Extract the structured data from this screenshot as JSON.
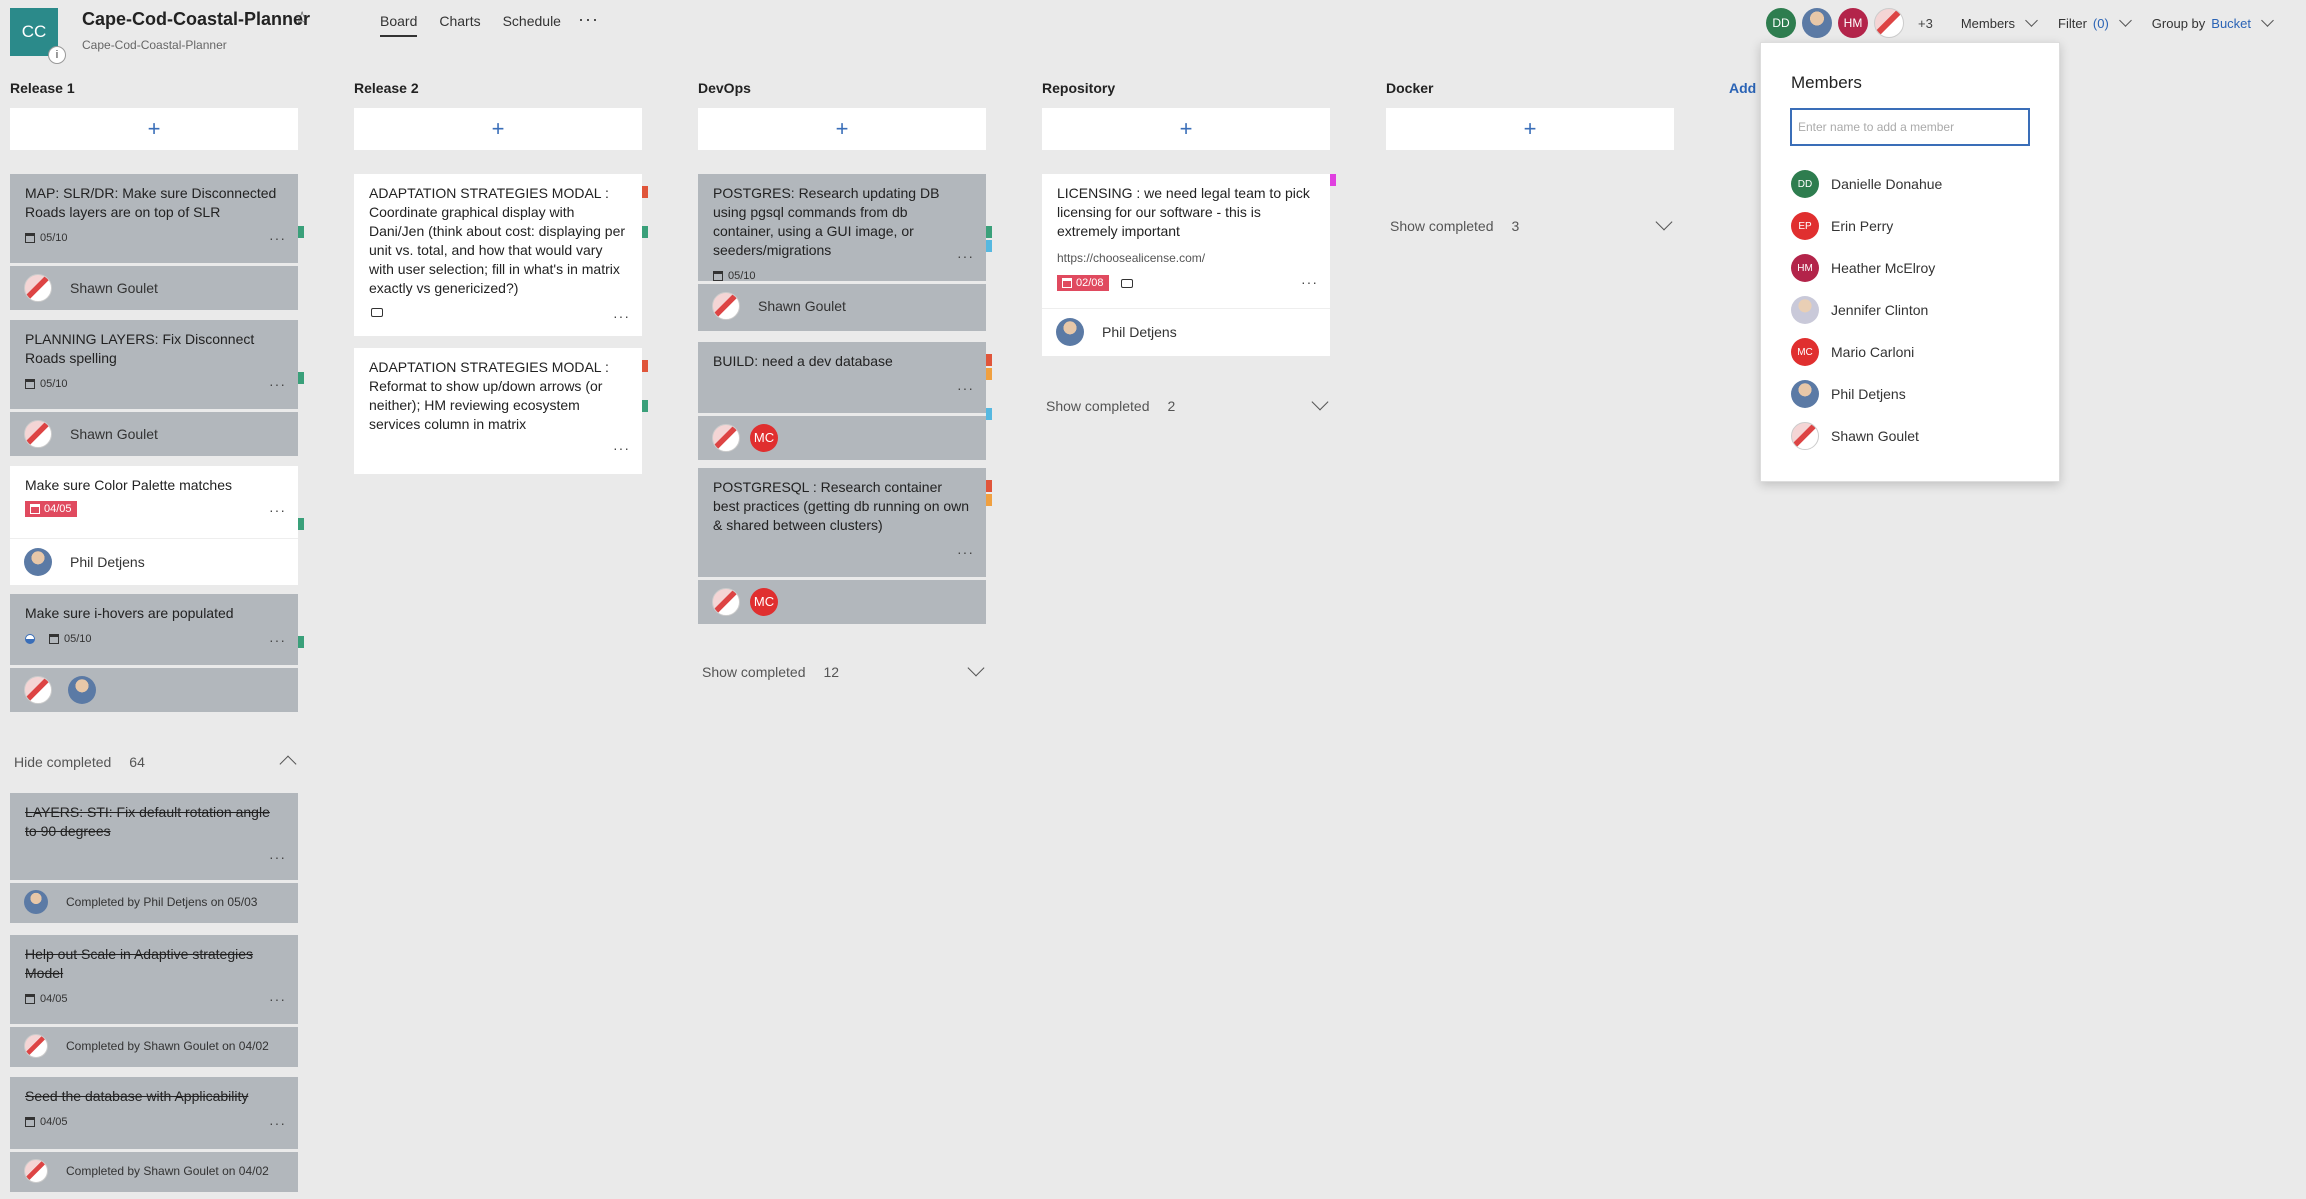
{
  "header": {
    "logo_initials": "CC",
    "logo_badge": "i",
    "plan_title": "Cape-Cod-Coastal-Planner",
    "plan_subtitle": "Cape-Cod-Coastal-Planner",
    "tabs": [
      "Board",
      "Charts",
      "Schedule"
    ],
    "more": "···",
    "members_avatars": [
      "DD",
      "",
      "HM",
      ""
    ],
    "extra_members": "+3",
    "members_label": "Members",
    "filter_label": "Filter",
    "filter_count": "(0)",
    "group_by_label": "Group by",
    "group_by_value": "Bucket"
  },
  "buckets": {
    "release1": "Release 1",
    "release2": "Release 2",
    "devops": "DevOps",
    "repository": "Repository",
    "docker": "Docker",
    "add_bucket": "Add"
  },
  "add_task_symbol": "+",
  "dots": "···",
  "release1": {
    "c1": {
      "title": "MAP: SLR/DR: Make sure Disconnected Roads layers are on top of SLR",
      "date": "05/10",
      "assignee": "Shawn Goulet"
    },
    "c2": {
      "title": "PLANNING LAYERS: Fix Disconnect Roads spelling",
      "date": "05/10",
      "assignee": "Shawn Goulet"
    },
    "c3": {
      "title": "Make sure Color Palette matches",
      "date": "04/05",
      "assignee": "Phil Detjens"
    },
    "c4": {
      "title": "Make sure i-hovers are populated",
      "date": "05/10"
    },
    "completed_label": "Hide completed",
    "completed_count": "64",
    "d1": {
      "title": "LAYERS: STI: Fix default rotation angle to 90 degrees",
      "by": "Completed by Phil Detjens on 05/03"
    },
    "d2": {
      "title": "Help out Scale in Adaptive strategies Model",
      "date": "04/05",
      "by": "Completed by Shawn Goulet on 04/02"
    },
    "d3": {
      "title": "Seed the database with Applicability",
      "date": "04/05",
      "by": "Completed by Shawn Goulet on 04/02"
    }
  },
  "release2": {
    "c1": {
      "title": "ADAPTATION STRATEGIES MODAL : Coordinate graphical display with Dani/Jen (think about cost: displaying per unit vs. total, and how that would vary with user selection; fill in what's in matrix exactly vs genericized?)"
    },
    "c2": {
      "title": "ADAPTATION STRATEGIES MODAL : Reformat to show up/down arrows (or neither); HM reviewing ecosystem services column in matrix"
    }
  },
  "devops": {
    "c1": {
      "title": "POSTGRES: Research updating DB using pgsql commands from db container, using a GUI image, or seeders/migrations",
      "date": "05/10",
      "assignee": "Shawn Goulet"
    },
    "c2": {
      "title": "BUILD: need a dev database",
      "assignee_initials": "MC"
    },
    "c3": {
      "title": "POSTGRESQL : Research container best practices (getting db running on own & shared between clusters)",
      "assignee_initials": "MC"
    },
    "completed_label": "Show completed",
    "completed_count": "12"
  },
  "repository": {
    "c1": {
      "title": "LICENSING : we need legal team to pick licensing for our software - this is extremely important",
      "link": "https://choosealicense.com/",
      "date": "02/08",
      "assignee": "Phil Detjens"
    },
    "completed_label": "Show completed",
    "completed_count": "2"
  },
  "docker": {
    "completed_label": "Show completed",
    "completed_count": "3"
  },
  "members_panel": {
    "title": "Members",
    "placeholder": "Enter name to add a member",
    "members": [
      {
        "initials": "DD",
        "name": "Danielle Donahue"
      },
      {
        "initials": "EP",
        "name": "Erin Perry"
      },
      {
        "initials": "HM",
        "name": "Heather McElroy"
      },
      {
        "initials": "",
        "name": "Jennifer Clinton"
      },
      {
        "initials": "MC",
        "name": "Mario Carloni"
      },
      {
        "initials": "",
        "name": "Phil Detjens"
      },
      {
        "initials": "",
        "name": "Shawn Goulet"
      }
    ]
  },
  "colors": {
    "accent": "#2b8a8a",
    "link": "#2a63b5",
    "card_gray": "#b2b7bc",
    "due_overdue": "#e04a5f",
    "tag_green": "#3aa07a",
    "tag_red": "#e0553a",
    "tag_blue": "#56b8e0",
    "tag_orange": "#f0a040",
    "tag_pink": "#e040e0"
  }
}
